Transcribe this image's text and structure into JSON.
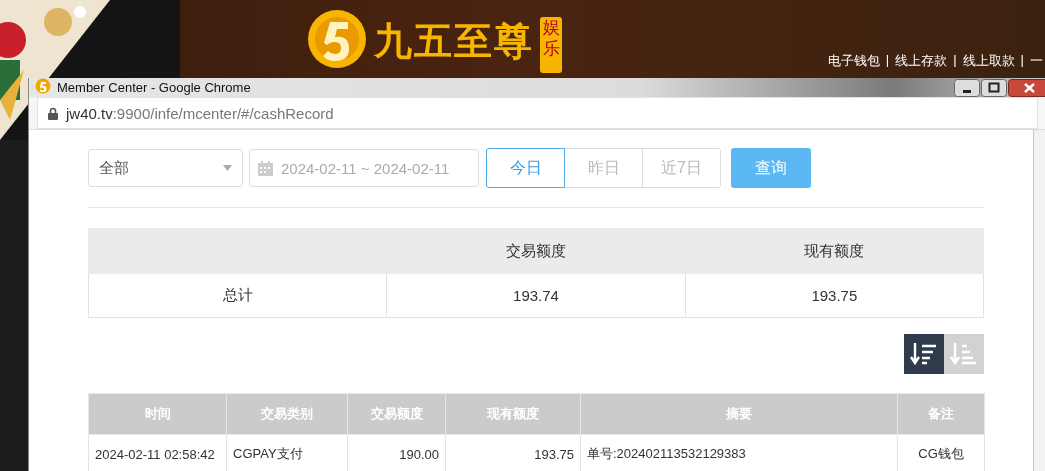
{
  "site": {
    "logo_text": "九五至尊",
    "logo_badge": "娱乐",
    "separator": "|",
    "nav": [
      "电子钱包",
      "线上存款",
      "线上取款",
      "一"
    ]
  },
  "window": {
    "title": "Member Center - Google Chrome",
    "url_host": "jw40.tv",
    "url_path": ":9900/infe/mcenter/#/cashRecord"
  },
  "filters": {
    "type_select": "全部",
    "date_range": "2024-02-11 ~ 2024-02-11",
    "quick_ranges": [
      {
        "label": "今日",
        "selected": true
      },
      {
        "label": "昨日",
        "selected": false
      },
      {
        "label": "近7日",
        "selected": false
      }
    ],
    "query_button": "查询"
  },
  "summary": {
    "columns": [
      "",
      "交易额度",
      "现有额度"
    ],
    "row": [
      "总计",
      "193.74",
      "193.75"
    ]
  },
  "sort_buttons": [
    {
      "kind": "desc",
      "selected": true
    },
    {
      "kind": "asc",
      "selected": false
    }
  ],
  "records": {
    "columns": [
      "时间",
      "交易类别",
      "交易额度",
      "现有额度",
      "摘要",
      "备注"
    ],
    "rows": [
      [
        "2024-02-11 02:58:42",
        "CGPAY支付",
        "190.00",
        "193.75",
        "单号:202402113532129383",
        "CG钱包"
      ]
    ]
  }
}
